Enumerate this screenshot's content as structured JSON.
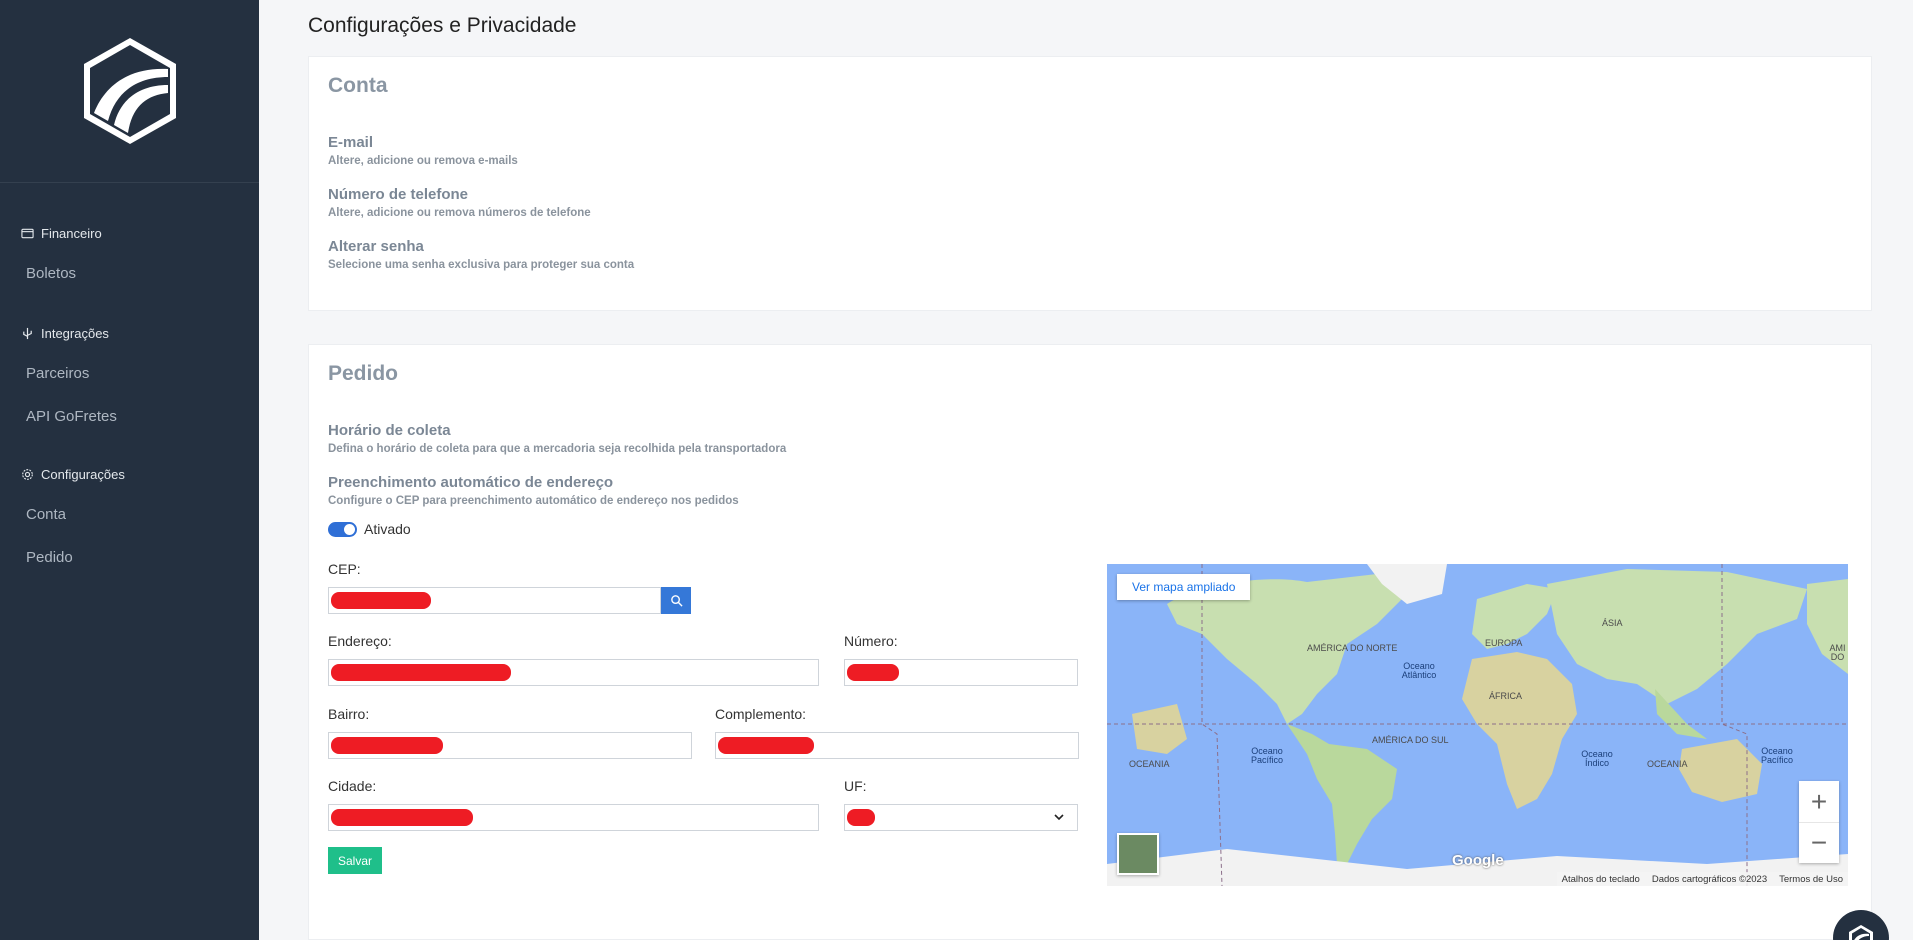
{
  "sidebar": {
    "groups": [
      {
        "label": "Financeiro",
        "items": [
          {
            "label": "Boletos"
          }
        ]
      },
      {
        "label": "Integrações",
        "items": [
          {
            "label": "Parceiros"
          },
          {
            "label": "API GoFretes"
          }
        ]
      },
      {
        "label": "Configurações",
        "items": [
          {
            "label": "Conta"
          },
          {
            "label": "Pedido"
          }
        ]
      }
    ]
  },
  "page": {
    "title": "Configurações e Privacidade"
  },
  "conta": {
    "title": "Conta",
    "options": [
      {
        "title": "E-mail",
        "subtitle": "Altere, adicione ou remova e-mails"
      },
      {
        "title": "Número de telefone",
        "subtitle": "Altere, adicione ou remova números de telefone"
      },
      {
        "title": "Alterar senha",
        "subtitle": "Selecione uma senha exclusiva para proteger sua conta"
      }
    ]
  },
  "pedido": {
    "title": "Pedido",
    "options": [
      {
        "title": "Horário de coleta",
        "subtitle": "Defina o horário de coleta para que a mercadoria seja recolhida pela transportadora"
      },
      {
        "title": "Preenchimento automático de endereço",
        "subtitle": "Configure o CEP para preenchimento automático de endereço nos pedidos"
      }
    ],
    "toggle_label": "Ativado",
    "form": {
      "cep": "CEP:",
      "endereco": "Endereço:",
      "numero": "Número:",
      "bairro": "Bairro:",
      "complemento": "Complemento:",
      "cidade": "Cidade:",
      "uf": "UF:",
      "save": "Salvar"
    }
  },
  "map": {
    "enlarge": "Ver mapa ampliado",
    "attribution": [
      "Atalhos do teclado",
      "Dados cartográficos ©2023",
      "Termos de Uso"
    ],
    "google": "Google",
    "labels": {
      "north_america": "AMÉRICA DO NORTE",
      "south_america": "AMÉRICA DO SUL",
      "europe": "EUROPA",
      "asia": "ÁSIA",
      "africa": "ÁFRICA",
      "oceania_w": "OCEANIA",
      "oceania_e": "OCEANIA",
      "am_right": "AMI DO",
      "atlantic": "Oceano Atlântico",
      "pacific_w": "Oceano Pacífico",
      "pacific_e": "Oceano Pacífico",
      "indian": "Oceano Índico"
    }
  },
  "colors": {
    "sidebar": "#243040",
    "accent": "#2f6fd6",
    "save": "#1fbf8a",
    "redaction": "#ee1c24"
  }
}
